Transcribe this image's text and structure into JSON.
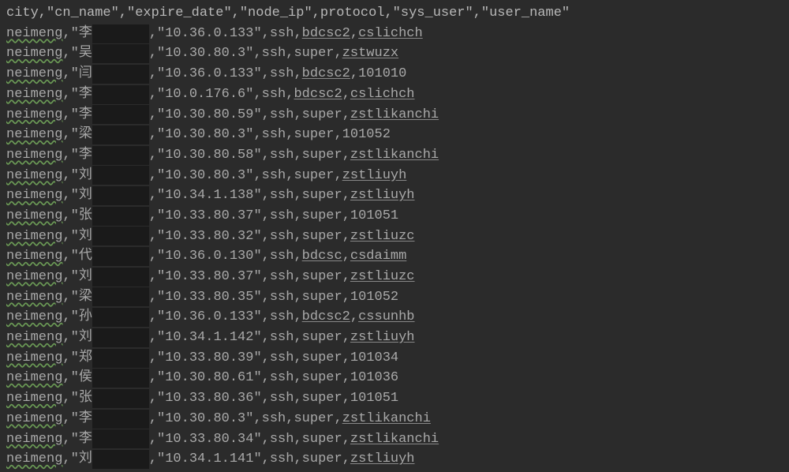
{
  "header": "city,\"cn_name\",\"expire_date\",\"node_ip\",protocol,\"sys_user\",\"user_name\"",
  "rows": [
    {
      "city": "neimeng",
      "cn_prefix": "李",
      "node_ip": "10.36.0.133",
      "protocol": "ssh",
      "sys_user": "bdcsc2",
      "user_name": "cslichch",
      "underline_user": true,
      "underline_sysuser": true
    },
    {
      "city": "neimeng",
      "cn_prefix": "吴",
      "node_ip": "10.30.80.3",
      "protocol": "ssh",
      "sys_user": "super",
      "user_name": "zstwuzx",
      "underline_user": true
    },
    {
      "city": "neimeng",
      "cn_prefix": "闫",
      "node_ip": "10.36.0.133",
      "protocol": "ssh",
      "sys_user": "bdcsc2",
      "user_name": "101010",
      "underline_sysuser": true
    },
    {
      "city": "neimeng",
      "cn_prefix": "李",
      "node_ip": "10.0.176.6",
      "protocol": "ssh",
      "sys_user": "bdcsc2",
      "user_name": "cslichch",
      "underline_user": true,
      "underline_sysuser": true
    },
    {
      "city": "neimeng",
      "cn_prefix": "李",
      "node_ip": "10.30.80.59",
      "protocol": "ssh",
      "sys_user": "super",
      "user_name": "zstlikanchi",
      "underline_user": true
    },
    {
      "city": "neimeng",
      "cn_prefix": "梁",
      "node_ip": "10.30.80.3",
      "protocol": "ssh",
      "sys_user": "super",
      "user_name": "101052"
    },
    {
      "city": "neimeng",
      "cn_prefix": "李",
      "node_ip": "10.30.80.58",
      "protocol": "ssh",
      "sys_user": "super",
      "user_name": "zstlikanchi",
      "underline_user": true
    },
    {
      "city": "neimeng",
      "cn_prefix": "刘",
      "node_ip": "10.30.80.3",
      "protocol": "ssh",
      "sys_user": "super",
      "user_name": "zstliuyh",
      "underline_user": true
    },
    {
      "city": "neimeng",
      "cn_prefix": "刘",
      "node_ip": "10.34.1.138",
      "protocol": "ssh",
      "sys_user": "super",
      "user_name": "zstliuyh",
      "underline_user": true
    },
    {
      "city": "neimeng",
      "cn_prefix": "张",
      "node_ip": "10.33.80.37",
      "protocol": "ssh",
      "sys_user": "super",
      "user_name": "101051"
    },
    {
      "city": "neimeng",
      "cn_prefix": "刘",
      "node_ip": "10.33.80.32",
      "protocol": "ssh",
      "sys_user": "super",
      "user_name": "zstliuzc",
      "underline_user": true
    },
    {
      "city": "neimeng",
      "cn_prefix": "代",
      "node_ip": "10.36.0.130",
      "protocol": "ssh",
      "sys_user": "bdcsc",
      "user_name": "csdaimm",
      "underline_user": true,
      "underline_sysuser": true
    },
    {
      "city": "neimeng",
      "cn_prefix": "刘",
      "node_ip": "10.33.80.37",
      "protocol": "ssh",
      "sys_user": "super",
      "user_name": "zstliuzc",
      "underline_user": true
    },
    {
      "city": "neimeng",
      "cn_prefix": "梁",
      "node_ip": "10.33.80.35",
      "protocol": "ssh",
      "sys_user": "super",
      "user_name": "101052"
    },
    {
      "city": "neimeng",
      "cn_prefix": "孙",
      "node_ip": "10.36.0.133",
      "protocol": "ssh",
      "sys_user": "bdcsc2",
      "user_name": "cssunhb",
      "underline_user": true,
      "underline_sysuser": true
    },
    {
      "city": "neimeng",
      "cn_prefix": "刘",
      "node_ip": "10.34.1.142",
      "protocol": "ssh",
      "sys_user": "super",
      "user_name": "zstliuyh",
      "underline_user": true
    },
    {
      "city": "neimeng",
      "cn_prefix": "郑",
      "node_ip": "10.33.80.39",
      "protocol": "ssh",
      "sys_user": "super",
      "user_name": "101034"
    },
    {
      "city": "neimeng",
      "cn_prefix": "侯",
      "node_ip": "10.30.80.61",
      "protocol": "ssh",
      "sys_user": "super",
      "user_name": "101036"
    },
    {
      "city": "neimeng",
      "cn_prefix": "张",
      "node_ip": "10.33.80.36",
      "protocol": "ssh",
      "sys_user": "super",
      "user_name": "101051"
    },
    {
      "city": "neimeng",
      "cn_prefix": "李",
      "node_ip": "10.30.80.3",
      "protocol": "ssh",
      "sys_user": "super",
      "user_name": "zstlikanchi",
      "underline_user": true
    },
    {
      "city": "neimeng",
      "cn_prefix": "李",
      "node_ip": "10.33.80.34",
      "protocol": "ssh",
      "sys_user": "super",
      "user_name": "zstlikanchi",
      "underline_user": true
    },
    {
      "city": "neimeng",
      "cn_prefix": "刘",
      "node_ip": "10.34.1.141",
      "protocol": "ssh",
      "sys_user": "super",
      "user_name": "zstliuyh",
      "underline_user": true
    }
  ]
}
